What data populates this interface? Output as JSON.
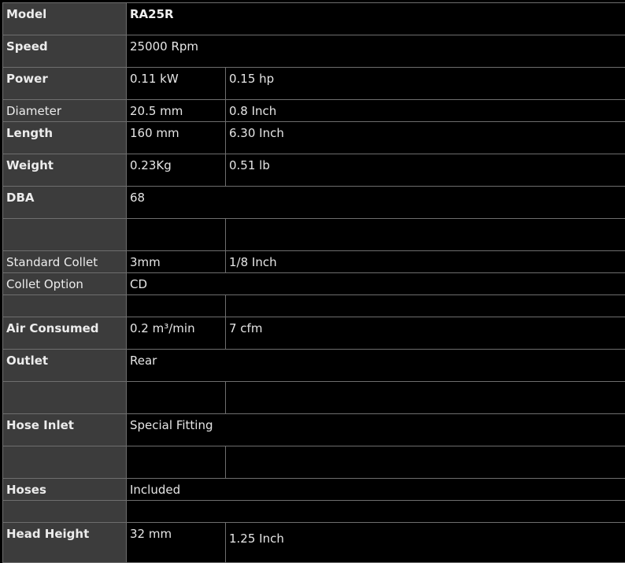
{
  "spec_table": {
    "rows": [
      {
        "label": "Model",
        "bold": true,
        "values": [
          "RA25R"
        ]
      },
      {
        "label": "Speed",
        "bold": true,
        "values": [
          "25000 Rpm"
        ]
      },
      {
        "label": "Power",
        "bold": true,
        "values": [
          "0.11 kW",
          "0.15 hp"
        ]
      },
      {
        "label": "Diameter",
        "bold": false,
        "values": [
          "20.5 mm",
          "0.8 Inch"
        ]
      },
      {
        "label": "Length",
        "bold": true,
        "values": [
          "160 mm",
          "6.30 Inch"
        ]
      },
      {
        "label": "Weight",
        "bold": true,
        "values": [
          "0.23Kg",
          "0.51 lb"
        ]
      },
      {
        "label": "DBA",
        "bold": true,
        "values": [
          "68"
        ]
      },
      {
        "label": "",
        "bold": false,
        "values": [
          "",
          ""
        ]
      },
      {
        "label": "Standard Collet",
        "bold": false,
        "values": [
          "3mm",
          "1/8 Inch"
        ]
      },
      {
        "label": "Collet Option",
        "bold": false,
        "values": [
          "CD"
        ]
      },
      {
        "label": "",
        "bold": false,
        "values": [
          "",
          ""
        ]
      },
      {
        "label": "Air Consumed",
        "bold": true,
        "values": [
          "0.2 m³/min",
          "7 cfm"
        ]
      },
      {
        "label": "Outlet",
        "bold": true,
        "values": [
          "Rear"
        ]
      },
      {
        "label": "",
        "bold": false,
        "values": [
          "",
          ""
        ]
      },
      {
        "label": "Hose Inlet",
        "bold": true,
        "values": [
          "Special Fitting"
        ]
      },
      {
        "label": "",
        "bold": false,
        "values": [
          "",
          ""
        ]
      },
      {
        "label": "Hoses",
        "bold": true,
        "values": [
          "Included"
        ]
      },
      {
        "label": "",
        "bold": false,
        "values": [
          ""
        ]
      },
      {
        "label": "Head Height",
        "bold": true,
        "values": [
          "32 mm",
          "1.25 Inch"
        ]
      }
    ]
  }
}
